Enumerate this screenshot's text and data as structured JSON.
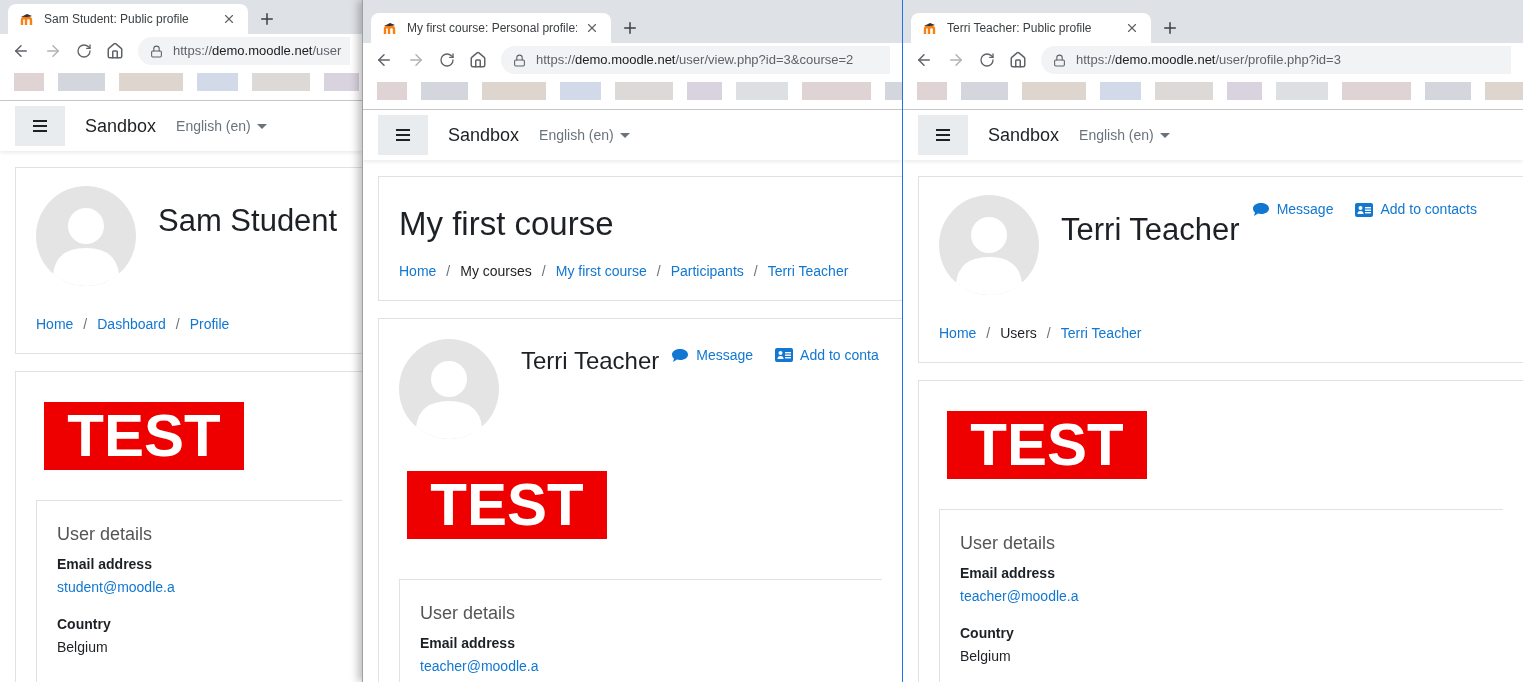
{
  "windows": [
    {
      "tab_title": "Sam Student: Public profile",
      "url": {
        "scheme": "https://",
        "host": "demo.moodle.net",
        "path": "/user"
      },
      "navbar": {
        "site": "Sandbox",
        "language": "English (en)"
      },
      "separator": "/",
      "header": {
        "kind": "profile",
        "title": "Sam Student",
        "breadcrumb": [
          {
            "label": "Home",
            "kind": "link"
          },
          {
            "label": "Dashboard",
            "kind": "link"
          },
          {
            "label": "Profile",
            "kind": "link"
          }
        ]
      },
      "banner": "TEST",
      "user_details": {
        "title": "User details",
        "fields": [
          {
            "label": "Email address",
            "value": "student@moodle.a",
            "kind": "link"
          },
          {
            "label": "Country",
            "value": "Belgium",
            "kind": "text"
          }
        ]
      }
    },
    {
      "tab_title": "My first course: Personal profile:",
      "url": {
        "scheme": "https://",
        "host": "demo.moodle.net",
        "path": "/user/view.php?id=3&course=2"
      },
      "navbar": {
        "site": "Sandbox",
        "language": "English (en)"
      },
      "separator": "/",
      "header": {
        "kind": "course",
        "title": "My first course",
        "breadcrumb": [
          {
            "label": "Home",
            "kind": "link"
          },
          {
            "label": "My courses",
            "kind": "text"
          },
          {
            "label": "My first course",
            "kind": "link"
          },
          {
            "label": "Participants",
            "kind": "link"
          },
          {
            "label": "Terri Teacher",
            "kind": "link"
          }
        ]
      },
      "profile_card": {
        "name": "Terri Teacher",
        "actions": [
          {
            "label": "Message",
            "kind": "message"
          },
          {
            "label": "Add to conta",
            "kind": "contact"
          }
        ]
      },
      "banner": "TEST",
      "user_details": {
        "title": "User details",
        "fields": [
          {
            "label": "Email address",
            "value": "teacher@moodle.a",
            "kind": "link"
          }
        ]
      }
    },
    {
      "tab_title": "Terri Teacher: Public profile",
      "url": {
        "scheme": "https://",
        "host": "demo.moodle.net",
        "path": "/user/profile.php?id=3"
      },
      "navbar": {
        "site": "Sandbox",
        "language": "English (en)"
      },
      "separator": "/",
      "header": {
        "kind": "profile",
        "title": "Terri Teacher",
        "actions": [
          {
            "label": "Message",
            "kind": "message"
          },
          {
            "label": "Add to contacts",
            "kind": "contact"
          }
        ],
        "breadcrumb": [
          {
            "label": "Home",
            "kind": "link"
          },
          {
            "label": "Users",
            "kind": "text"
          },
          {
            "label": "Terri Teacher",
            "kind": "link"
          }
        ]
      },
      "banner": "TEST",
      "user_details": {
        "title": "User details",
        "fields": [
          {
            "label": "Email address",
            "value": "teacher@moodle.a",
            "kind": "link"
          },
          {
            "label": "Country",
            "value": "Belgium",
            "kind": "text"
          }
        ]
      }
    }
  ]
}
